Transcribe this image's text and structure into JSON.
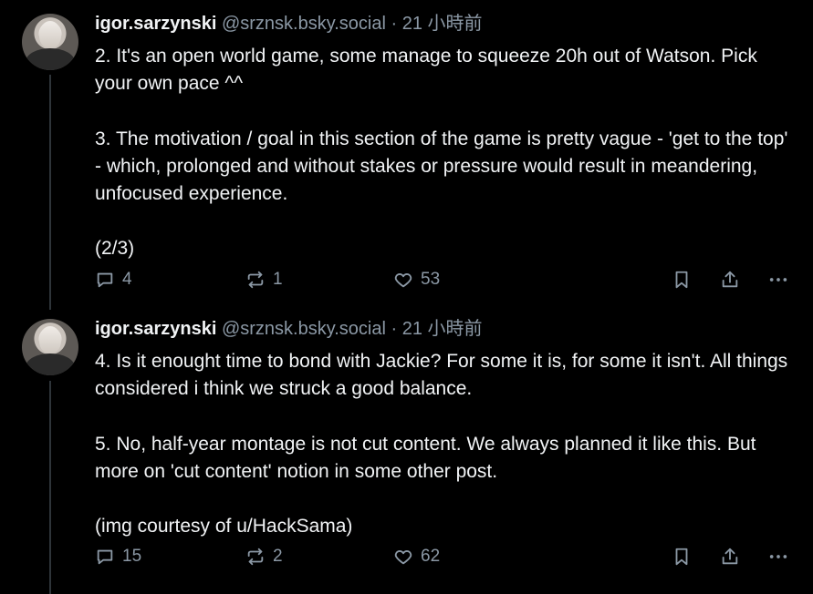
{
  "posts": [
    {
      "author_name": "igor.sarzynski",
      "handle": "@srznsk.bsky.social",
      "separator": "·",
      "time": "21 小時前",
      "text": "2. It's an open world game, some manage to squeeze 20h out of Watson. Pick your own pace ^^\n\n3. The motivation / goal in this section of the game is pretty vague - 'get to the top' - which, prolonged and without stakes or pressure would result in meandering, unfocused experience.\n\n(2/3)",
      "reply_count": "4",
      "repost_count": "1",
      "like_count": "53"
    },
    {
      "author_name": "igor.sarzynski",
      "handle": "@srznsk.bsky.social",
      "separator": "·",
      "time": "21 小時前",
      "text": "4. Is it enought time to bond with Jackie? For some it is, for some it isn't. All things considered i think we struck a good balance.\n\n5. No, half-year montage is not cut content. We always planned it like this. But more on 'cut content' notion in some other post.\n\n(img courtesy of u/HackSama)",
      "reply_count": "15",
      "repost_count": "2",
      "like_count": "62"
    }
  ],
  "icons": {
    "reply": "reply-icon",
    "repost": "repost-icon",
    "like": "heart-icon",
    "bookmark": "bookmark-icon",
    "share": "share-icon",
    "more": "more-icon"
  },
  "colors": {
    "background": "#000000",
    "text": "#f1f3f5",
    "muted": "#8b98a5",
    "thread_line": "#2e3439"
  }
}
